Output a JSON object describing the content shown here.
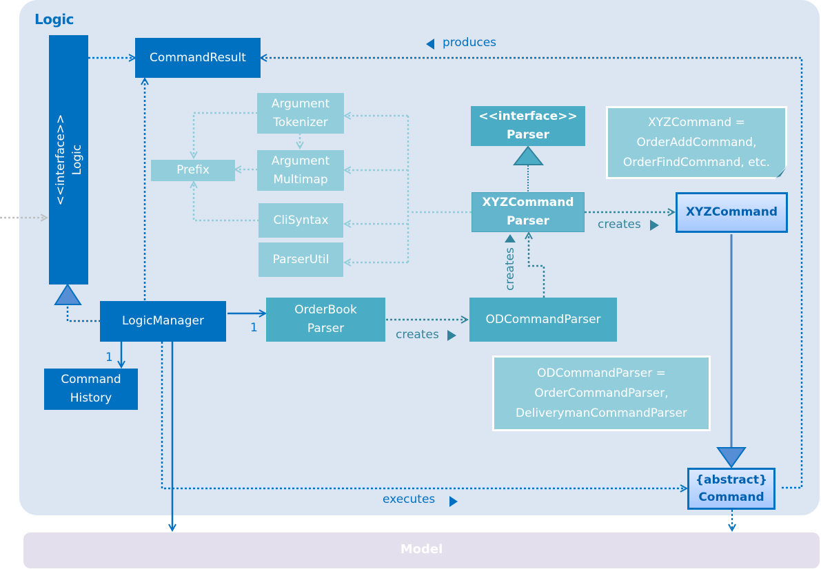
{
  "package": {
    "title": "Logic"
  },
  "model": {
    "label": "Model"
  },
  "classes": {
    "logic_interface": {
      "stereotype": "<<interface>>",
      "name": "Logic"
    },
    "command_result": {
      "name": "CommandResult"
    },
    "logic_manager": {
      "name": "LogicManager"
    },
    "command_history": {
      "name": "Command\nHistory"
    },
    "orderbook_parser": {
      "name": "OrderBook\nParser"
    },
    "od_command_parser": {
      "name": "ODCommandParser"
    },
    "parser_interface": {
      "name": "<<interface>>\nParser"
    },
    "xyz_command_parser": {
      "name": "XYZCommand\nParser"
    },
    "xyz_command": {
      "name": "XYZCommand"
    },
    "abstract_command": {
      "name": "{abstract}\nCommand"
    },
    "argument_tokenizer": {
      "name": "Argument\nTokenizer"
    },
    "argument_multimap": {
      "name": "Argument\nMultimap"
    },
    "prefix": {
      "name": "Prefix"
    },
    "cli_syntax": {
      "name": "CliSyntax"
    },
    "parser_util": {
      "name": "ParserUtil"
    }
  },
  "notes": {
    "xyz_note": "XYZCommand =\nOrderAddCommand,\nOrderFindCommand, etc.",
    "od_note": "ODCommandParser =\nOrderCommandParser,\nDeliverymanCommandParser"
  },
  "labels": {
    "produces": "produces",
    "executes": "executes",
    "creates_orderbook": "creates",
    "creates_xyz": "creates",
    "creates_vertical": "creates",
    "multiplicity_history": "1",
    "multiplicity_orderbook": "1"
  },
  "colors": {
    "dark_blue": "#0070c0",
    "teal": "#4bacc6",
    "light_teal": "#92cddc",
    "package_bg": "#dce6f2",
    "model_bg": "#e4dfec"
  }
}
